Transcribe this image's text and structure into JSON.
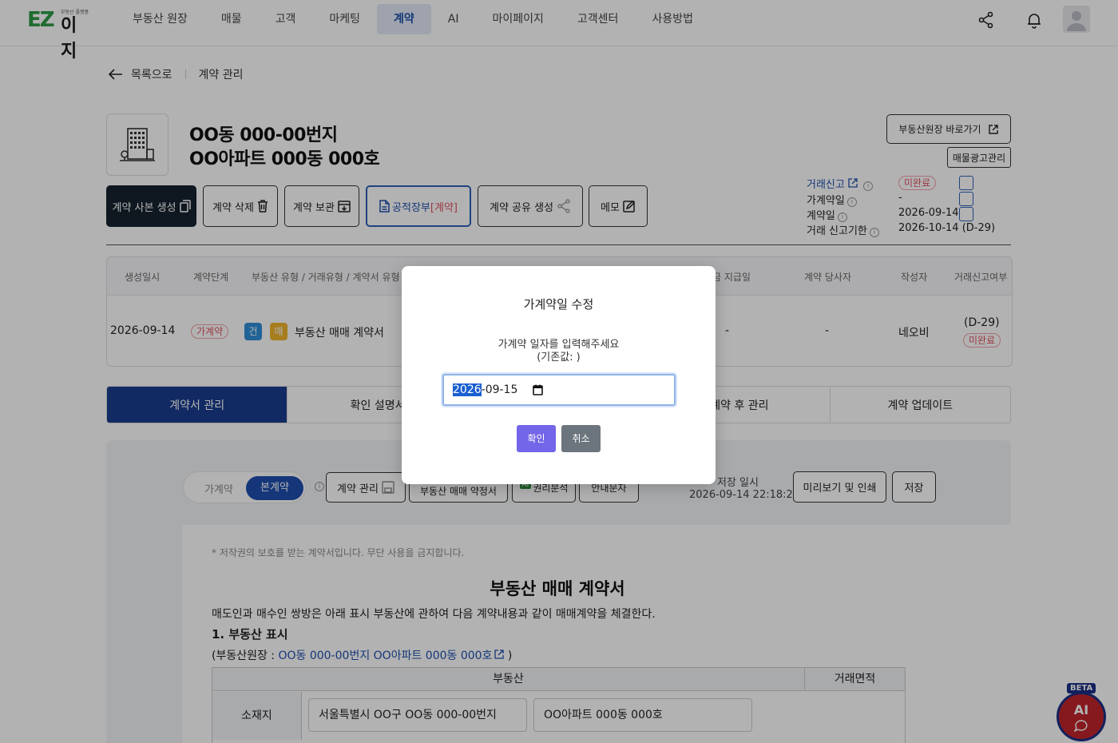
{
  "brand": {
    "mark": "EZ",
    "name": "이지",
    "tagline": "부동산 플랫폼"
  },
  "nav": [
    "부동산 원장",
    "매물",
    "고객",
    "마케팅",
    "계약",
    "AI",
    "마이페이지",
    "고객센터",
    "사용방법"
  ],
  "nav_active": "계약",
  "breadcrumb": {
    "back": "목록으로",
    "current": "계약 관리"
  },
  "property": {
    "title_line1": "OO동 000-00번지",
    "title_line2": "OO아파트 000동 000호"
  },
  "actions": {
    "copy": "계약 사본 생성",
    "delete": "계약 삭제",
    "archive": "계약 보관",
    "ledger_prefix": "공적장부",
    "ledger_suffix": "[계약]",
    "share": "계약 공유 생성",
    "memo": "메모",
    "goto_ledger": "부동산원장 바로가기",
    "ad_manage": "매물광고관리"
  },
  "status": {
    "report_label": "거래신고",
    "report_value": "미완료",
    "prelim_label": "가계약일",
    "prelim_value": "-",
    "contract_label": "계약일",
    "contract_value": "2026-09-14",
    "deadline_label": "거래 신고기한",
    "deadline_value": "2026-10-14",
    "deadline_dday": "(D-29)"
  },
  "table": {
    "headers": [
      "생성일시",
      "계약단계",
      "부동산 유형 / 거래유형 / 계약서 유형",
      "금 지급일",
      "계약 당사자",
      "작성자",
      "거래신고여부"
    ],
    "row": {
      "created": "2026-09-14",
      "stage": "가계약",
      "type_badge1": "건",
      "type_badge2": "매",
      "doc_type": "부동산 매매 계약서",
      "pay_date": "-",
      "party": "-",
      "author": "네오비",
      "report_dday": "(D-29)",
      "report_status": "미완료"
    }
  },
  "tabs": [
    "계약서 관리",
    "확인 설명서",
    "",
    "계약 후 관리",
    "계약 업데이트"
  ],
  "tab_active": "계약서 관리",
  "editor": {
    "toggle_off": "가계약",
    "toggle_on": "본계약",
    "contract_manage": "계약 관리",
    "doc_template": "부동산 매매 약정서",
    "ai_badge": "AI",
    "rights_analysis": "권리분석",
    "guide": "안내문자",
    "save_time_label": "저장 일시",
    "save_time": "2026-09-14 22:18:20",
    "preview": "미리보기 및 인쇄",
    "save": "저장"
  },
  "document": {
    "copyright": "* 저작권의 보호를 받는 계약서입니다. 무단 사용을 금지합니다.",
    "title": "부동산 매매 계약서",
    "intro": "매도인과 매수인 쌍방은 아래 표시 부동산에 관하여 다음 계약내용과 같이 매매계약을 체결한다.",
    "section1": "1. 부동산 표시",
    "ledger_prefix": "(부동산원장 : ",
    "ledger_link": "OO동 000-00번지 OO아파트 000동 000호",
    "ledger_suffix": " )",
    "col_property": "부동산",
    "col_area": "거래면적",
    "row_location": "소재지",
    "addr1": "서울특별시 OO구 OO동 000-00번지",
    "addr2": "OO아파트 000동 000호"
  },
  "ai_fab": {
    "label": "AI",
    "beta": "BETA"
  },
  "modal": {
    "title": "가계약일 수정",
    "desc": "가계약 일자를 입력해주세요",
    "default_note": "(기존값: )",
    "date_year": "2026",
    "date_rest": "-09-15",
    "confirm": "확인",
    "cancel": "취소"
  },
  "colors": {
    "primary": "#1a3d8f",
    "accent_purple": "#7366e8",
    "danger": "#e05161",
    "nav_active_bg": "#e3eaf8"
  }
}
